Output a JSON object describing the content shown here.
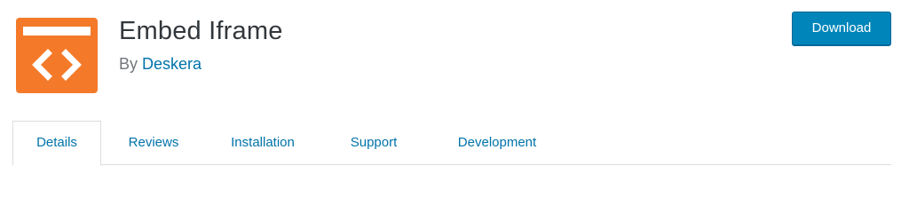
{
  "plugin": {
    "title": "Embed Iframe",
    "by_prefix": "By",
    "author": "Deskera",
    "icon_name": "embed-code-icon",
    "icon_color": "#f47a2a"
  },
  "actions": {
    "download_label": "Download"
  },
  "tabs": [
    {
      "label": "Details",
      "active": true
    },
    {
      "label": "Reviews",
      "active": false
    },
    {
      "label": "Installation",
      "active": false
    },
    {
      "label": "Support",
      "active": false
    },
    {
      "label": "Development",
      "active": false
    }
  ],
  "colors": {
    "link": "#0073aa",
    "button": "#0085ba",
    "title": "#32373c"
  }
}
